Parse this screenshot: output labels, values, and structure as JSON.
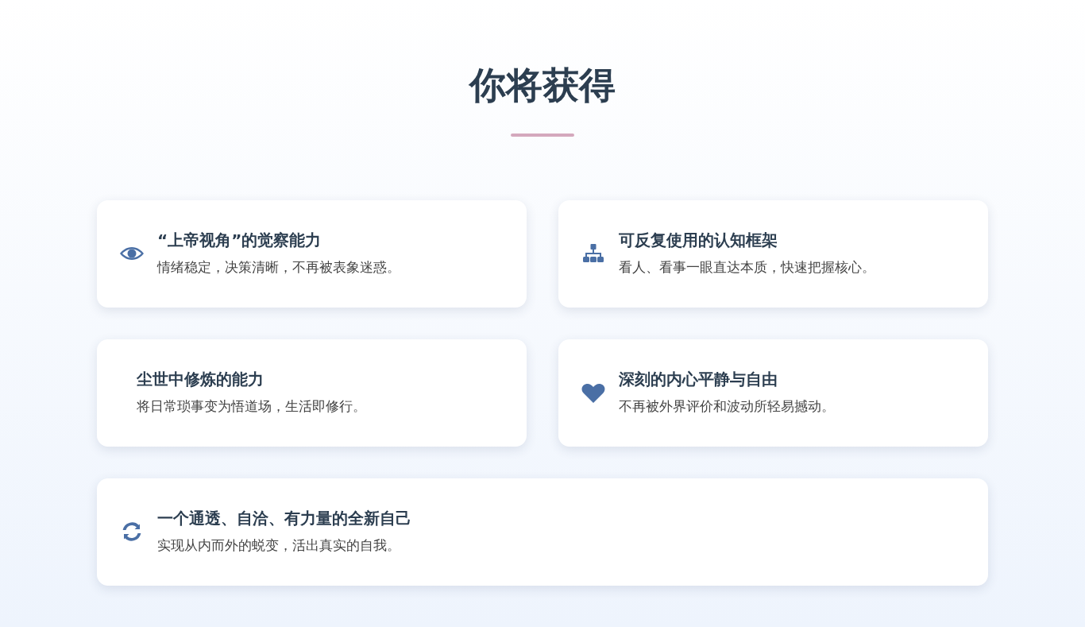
{
  "title": "你将获得",
  "cards": [
    {
      "title": "“上帝视角”的觉察能力",
      "text": "情绪稳定，决策清晰，不再被表象迷惑。"
    },
    {
      "title": "可反复使用的认知框架",
      "text": "看人、看事一眼直达本质，快速把握核心。"
    },
    {
      "title": "尘世中修炼的能力",
      "text": "将日常琐事变为悟道场，生活即修行。"
    },
    {
      "title": "深刻的内心平静与自由",
      "text": "不再被外界评价和波动所轻易撼动。"
    },
    {
      "title": "一个通透、自洽、有力量的全新自己",
      "text": "实现从内而外的蜕变，活出真实的自我。"
    }
  ]
}
